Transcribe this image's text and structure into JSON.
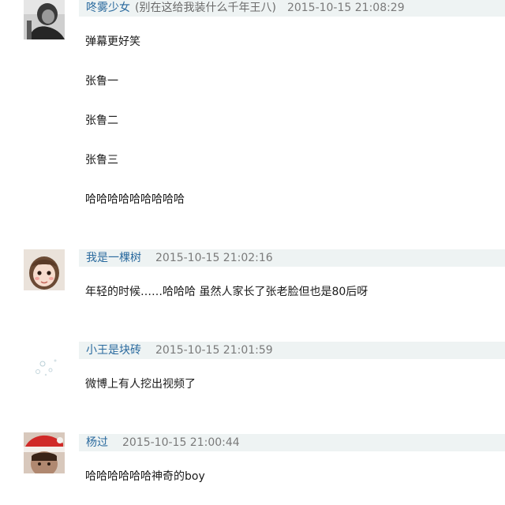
{
  "comments": [
    {
      "user": "咚雾少女",
      "note": "(别在这给我装什么千年王八)",
      "time": "2015-10-15 21:08:29",
      "lines": [
        "弹幕更好笑",
        "张鲁一",
        "张鲁二",
        "张鲁三",
        "哈哈哈哈哈哈哈哈哈"
      ],
      "avatar_icon": "grayscale-portrait-icon"
    },
    {
      "user": "我是一棵树",
      "time": "2015-10-15 21:02:16",
      "lines": [
        "年轻的时候……哈哈哈 虽然人家长了张老脸但也是80后呀"
      ],
      "avatar_icon": "child-portrait-icon"
    },
    {
      "user": "小王是块砖",
      "time": "2015-10-15 21:01:59",
      "lines": [
        "微博上有人挖出视频了"
      ],
      "avatar_icon": "faint-bubbles-icon"
    },
    {
      "user": "杨过",
      "time": "2015-10-15 21:00:44",
      "lines": [
        "哈哈哈哈哈哈神奇的boy"
      ],
      "avatar_icon": "santa-hat-portrait-icon"
    }
  ],
  "colors": {
    "username": "#2a6a9e",
    "meta_bar": "#eef3f3",
    "text": "#1a1a1a",
    "meta_text": "#7a7a7a"
  }
}
